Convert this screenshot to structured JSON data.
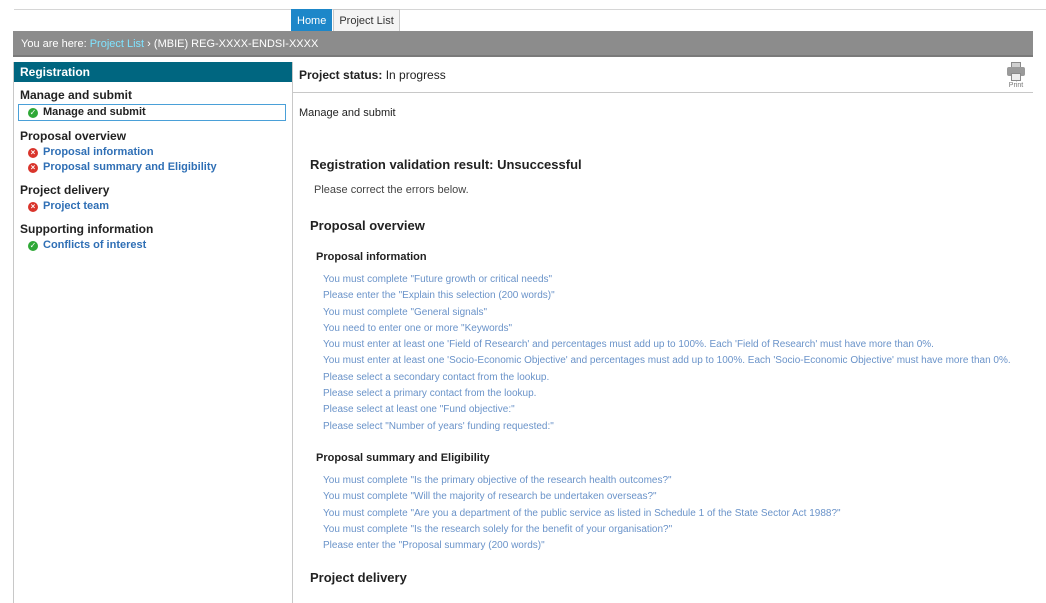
{
  "tabs": [
    {
      "label": "Home",
      "active": true
    },
    {
      "label": "Project List",
      "active": false
    }
  ],
  "breadcrumb": {
    "prefix": "You are here: ",
    "link": "Project List",
    "separator": " › ",
    "current": "(MBIE) REG-XXXX-ENDSI-XXXX"
  },
  "sidebar": {
    "header": "Registration",
    "sections": [
      {
        "title": "Manage and submit",
        "items": [
          {
            "label": "Manage and submit",
            "status": "ok"
          }
        ]
      },
      {
        "title": "Proposal overview",
        "items": [
          {
            "label": "Proposal information",
            "status": "error"
          },
          {
            "label": "Proposal summary and Eligibility",
            "status": "error"
          }
        ]
      },
      {
        "title": "Project delivery",
        "items": [
          {
            "label": "Project team",
            "status": "error"
          }
        ]
      },
      {
        "title": "Supporting information",
        "items": [
          {
            "label": "Conflicts of interest",
            "status": "ok"
          }
        ]
      }
    ]
  },
  "main": {
    "status_label": "Project status:",
    "status_value": "In progress",
    "print_label": "Print",
    "page_subtitle": "Manage and submit",
    "result_heading": "Registration validation result: Unsuccessful",
    "result_note": "Please correct the errors below.",
    "section1_title": "Proposal overview",
    "group1_title": "Proposal information",
    "group1_errors": [
      "You must complete \"Future growth or critical needs\"",
      "Please enter the \"Explain this selection (200 words)\"",
      "You must complete \"General signals\"",
      "You need to enter one or more \"Keywords\"",
      "You must enter at least one 'Field of Research' and percentages must add up to 100%. Each 'Field of Research' must have more than 0%.",
      "You must enter at least one 'Socio-Economic Objective' and percentages must add up to 100%. Each 'Socio-Economic Objective' must have more than 0%.",
      "Please select a secondary contact from the lookup.",
      "Please select a primary contact from the lookup.",
      "Please select at least one \"Fund objective:\"",
      "Please select \"Number of years' funding requested:\""
    ],
    "group2_title": "Proposal summary and Eligibility",
    "group2_errors": [
      "You must complete \"Is the primary objective of the research health outcomes?\"",
      "You must complete \"Will the majority of research be undertaken overseas?\"",
      "You must complete \"Are you a department of the public service as listed in Schedule 1 of the State Sector Act 1988?\"",
      "You must complete \"Is the research solely for the benefit of your organisation?\"",
      "Please enter the \"Proposal summary (200 words)\""
    ],
    "section2_title": "Project delivery"
  },
  "colors": {
    "tab_active": "#1d87c9",
    "sidebar_header": "#006680",
    "breadcrumb_bar": "#8c8c8c",
    "ok": "#2ea836",
    "error": "#d9342b",
    "link": "#2f6fb5"
  }
}
